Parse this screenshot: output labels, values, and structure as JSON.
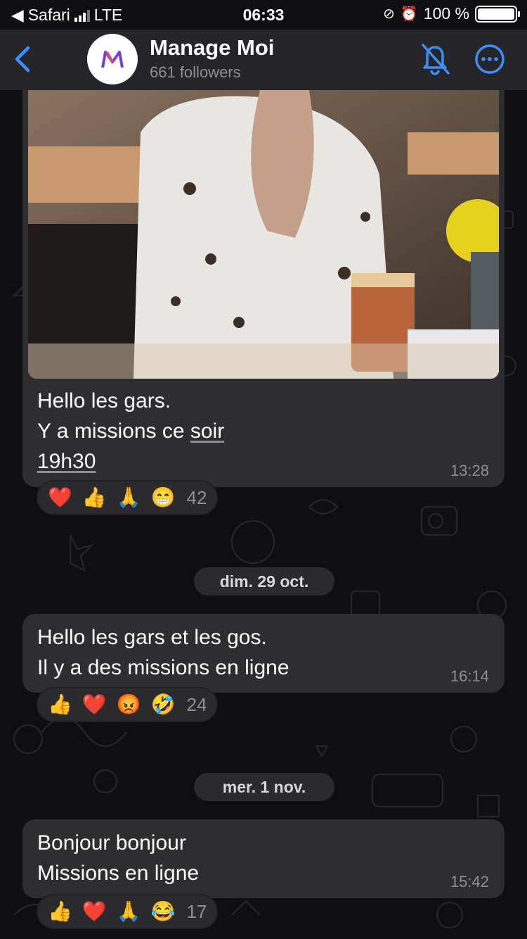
{
  "status_bar": {
    "carrier": "Safari",
    "network": "LTE",
    "time": "06:33",
    "battery_pct": "100 %",
    "battery_level": 1.0
  },
  "header": {
    "back_icon": "chevron-left-icon",
    "channel_name": "Manage Moi",
    "followers": "661 followers",
    "mute_icon": "bell-slash-icon",
    "more_icon": "ellipsis-circle-icon",
    "accent": "#3e8ef7"
  },
  "messages": [
    {
      "line1": "Hello les gars.",
      "line2_a": "Y a missions ce ",
      "line2_b": "soir",
      "line3": "19h30",
      "time": "13:28",
      "reactions": [
        "❤️",
        "👍",
        "🙏",
        "😁"
      ],
      "count": "42"
    },
    {
      "date": "dim. 29 oct.",
      "line1": "Hello les gars et les gos.",
      "line2": "Il y a des missions en ligne",
      "time": "16:14",
      "reactions": [
        "👍",
        "❤️",
        "😡",
        "🤣"
      ],
      "count": "24"
    },
    {
      "date": "mer. 1 nov.",
      "line1": "Bonjour bonjour",
      "line2": "Missions en ligne",
      "time": "15:42",
      "reactions": [
        "👍",
        "❤️",
        "🙏",
        "😂"
      ],
      "count": "17"
    }
  ]
}
